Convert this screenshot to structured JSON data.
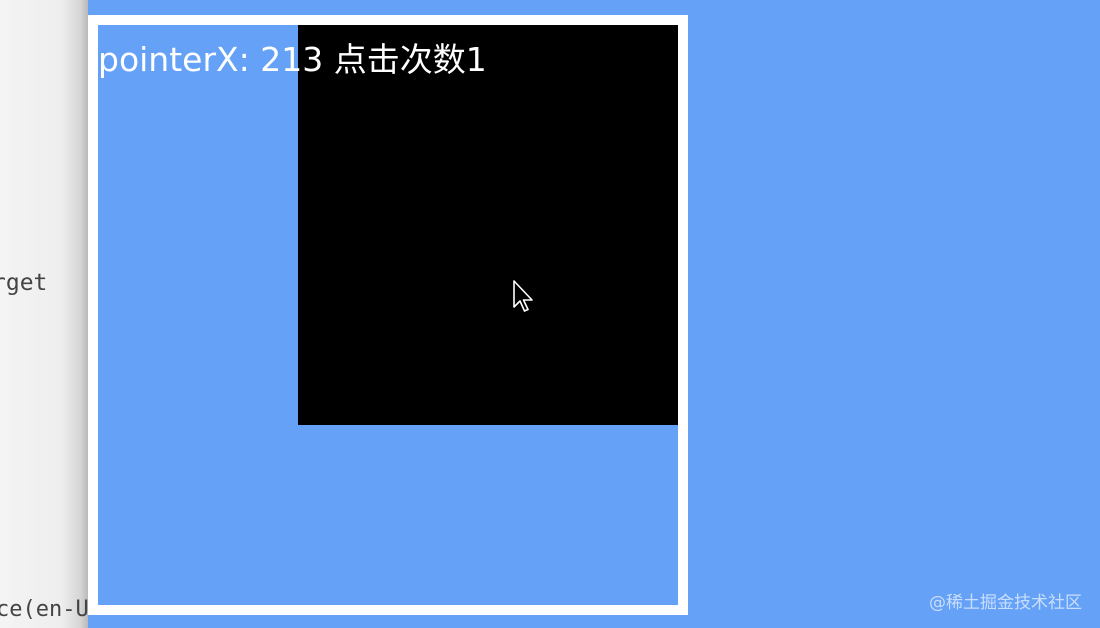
{
  "side_pane": {
    "line_1": "rget",
    "line_2": "ce(en-U"
  },
  "demo": {
    "readout": "pointerX: 213 点击次数1"
  },
  "watermark": "@稀土掘金技术社区"
}
